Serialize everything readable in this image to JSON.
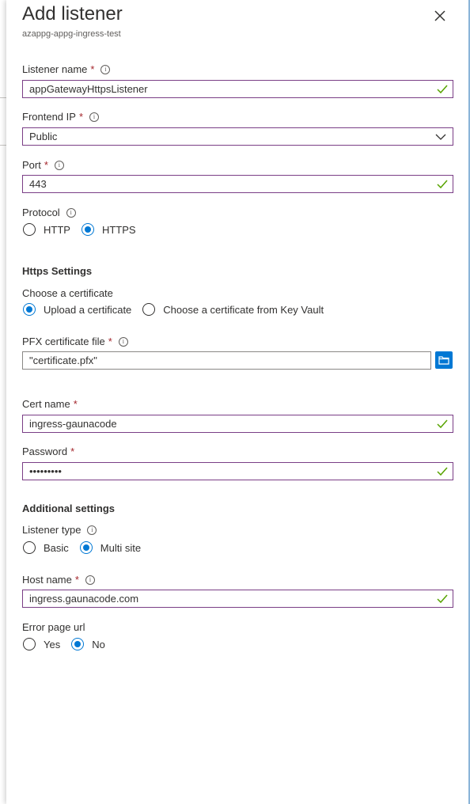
{
  "header": {
    "title": "Add listener",
    "subtitle": "azappg-appg-ingress-test"
  },
  "listener_name": {
    "label": "Listener name",
    "required": "*",
    "value": "appGatewayHttpsListener"
  },
  "frontend_ip": {
    "label": "Frontend IP",
    "required": "*",
    "value": "Public"
  },
  "port": {
    "label": "Port",
    "required": "*",
    "value": "443"
  },
  "protocol": {
    "label": "Protocol",
    "options": [
      "HTTP",
      "HTTPS"
    ],
    "selected": "HTTPS"
  },
  "https_settings": {
    "heading": "Https Settings",
    "choose_label": "Choose a certificate",
    "options": [
      "Upload a certificate",
      "Choose a certificate from Key Vault"
    ],
    "selected": "Upload a certificate"
  },
  "pfx": {
    "label": "PFX certificate file",
    "required": "*",
    "value": "\"certificate.pfx\""
  },
  "cert_name": {
    "label": "Cert name",
    "required": "*",
    "value": "ingress-gaunacode"
  },
  "password": {
    "label": "Password",
    "required": "*",
    "value": "•••••••••"
  },
  "additional": {
    "heading": "Additional settings"
  },
  "listener_type": {
    "label": "Listener type",
    "options": [
      "Basic",
      "Multi site"
    ],
    "selected": "Multi site"
  },
  "host_name": {
    "label": "Host name",
    "required": "*",
    "value": "ingress.gaunacode.com"
  },
  "error_page": {
    "label": "Error page url",
    "options": [
      "Yes",
      "No"
    ],
    "selected": "No"
  },
  "colors": {
    "accent": "#0078d4",
    "field_border": "#7a3e86",
    "valid_check": "#57a300",
    "required": "#a4262c"
  },
  "icons": {
    "close": "close-icon",
    "info": "info-icon",
    "check": "checkmark-icon",
    "chevron": "chevron-down-icon",
    "browse": "folder-icon"
  }
}
